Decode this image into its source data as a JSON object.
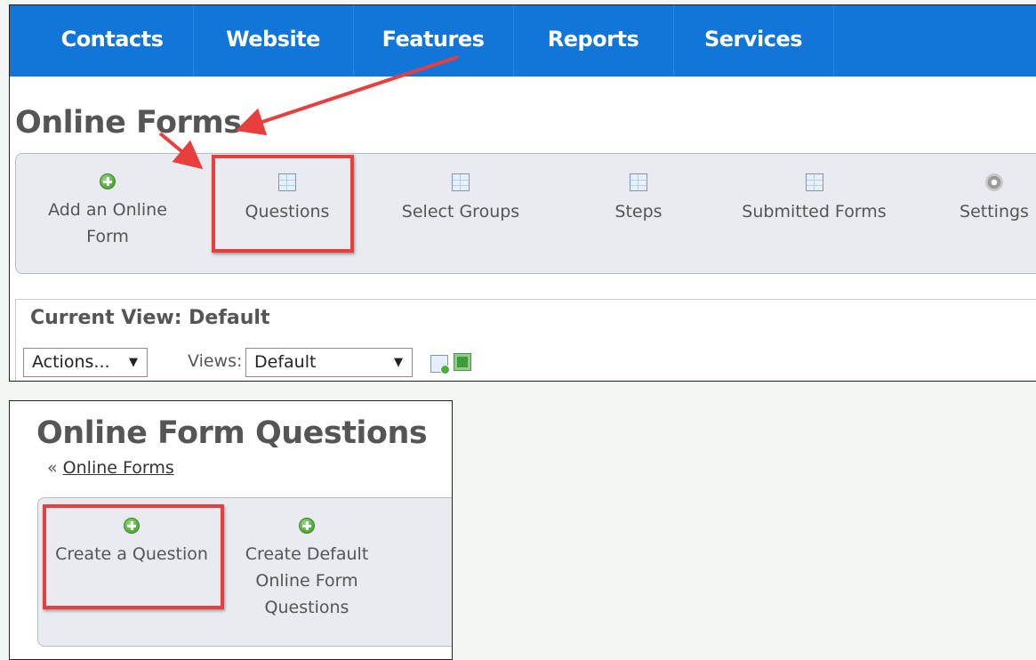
{
  "nav": {
    "items": [
      "Contacts",
      "Website",
      "Features",
      "Reports",
      "Services"
    ]
  },
  "online_forms_page": {
    "title": "Online Forms",
    "toolbar": [
      {
        "label": "Add an Online Form",
        "icon": "plus-circle-icon"
      },
      {
        "label": "Questions",
        "icon": "grid-icon"
      },
      {
        "label": "Select Groups",
        "icon": "grid-icon"
      },
      {
        "label": "Steps",
        "icon": "grid-icon"
      },
      {
        "label": "Submitted Forms",
        "icon": "grid-icon"
      },
      {
        "label": "Settings",
        "icon": "gear-icon"
      }
    ],
    "current_view": {
      "label": "Current View: Default",
      "actions_value": "Actions...",
      "views_label": "Views:",
      "views_value": "Default"
    }
  },
  "questions_page": {
    "title": "Online Form Questions",
    "breadcrumb_prefix": "«",
    "breadcrumb_link": "Online Forms",
    "toolbar": [
      {
        "label": "Create a Question",
        "icon": "plus-circle-icon"
      },
      {
        "label": "Create Default Online Form Questions",
        "icon": "plus-circle-icon"
      }
    ]
  },
  "colors": {
    "nav_bg": "#1275d8",
    "callout": "#e83e3e",
    "toolbar_bg": "#e9ebf1",
    "page_bg": "#f2f7f3"
  }
}
